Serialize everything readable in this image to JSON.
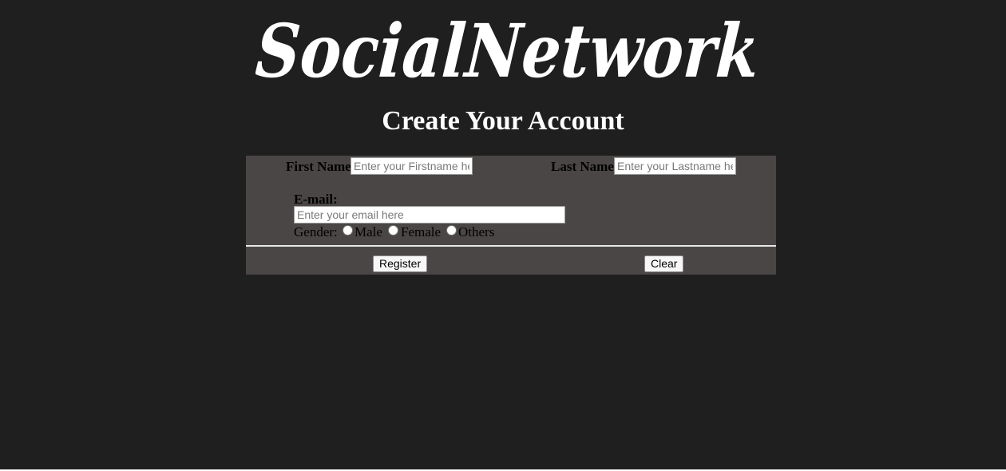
{
  "brand": {
    "logo_text": "SocialNetwork"
  },
  "heading": "Create Your Account",
  "form": {
    "first_name": {
      "label": "First Name",
      "placeholder": "Enter your Firstname here"
    },
    "last_name": {
      "label": "Last Name",
      "placeholder": "Enter your Lastname here"
    },
    "email": {
      "label": "E-mail:",
      "placeholder": "Enter your email here"
    },
    "gender": {
      "label": "Gender:",
      "options": [
        "Male",
        "Female",
        "Others"
      ]
    },
    "register_label": "Register",
    "clear_label": "Clear"
  },
  "colors": {
    "page_background": "#1f1f1f",
    "panel_background": "#4a4645",
    "heading_text": "#ffffff"
  }
}
